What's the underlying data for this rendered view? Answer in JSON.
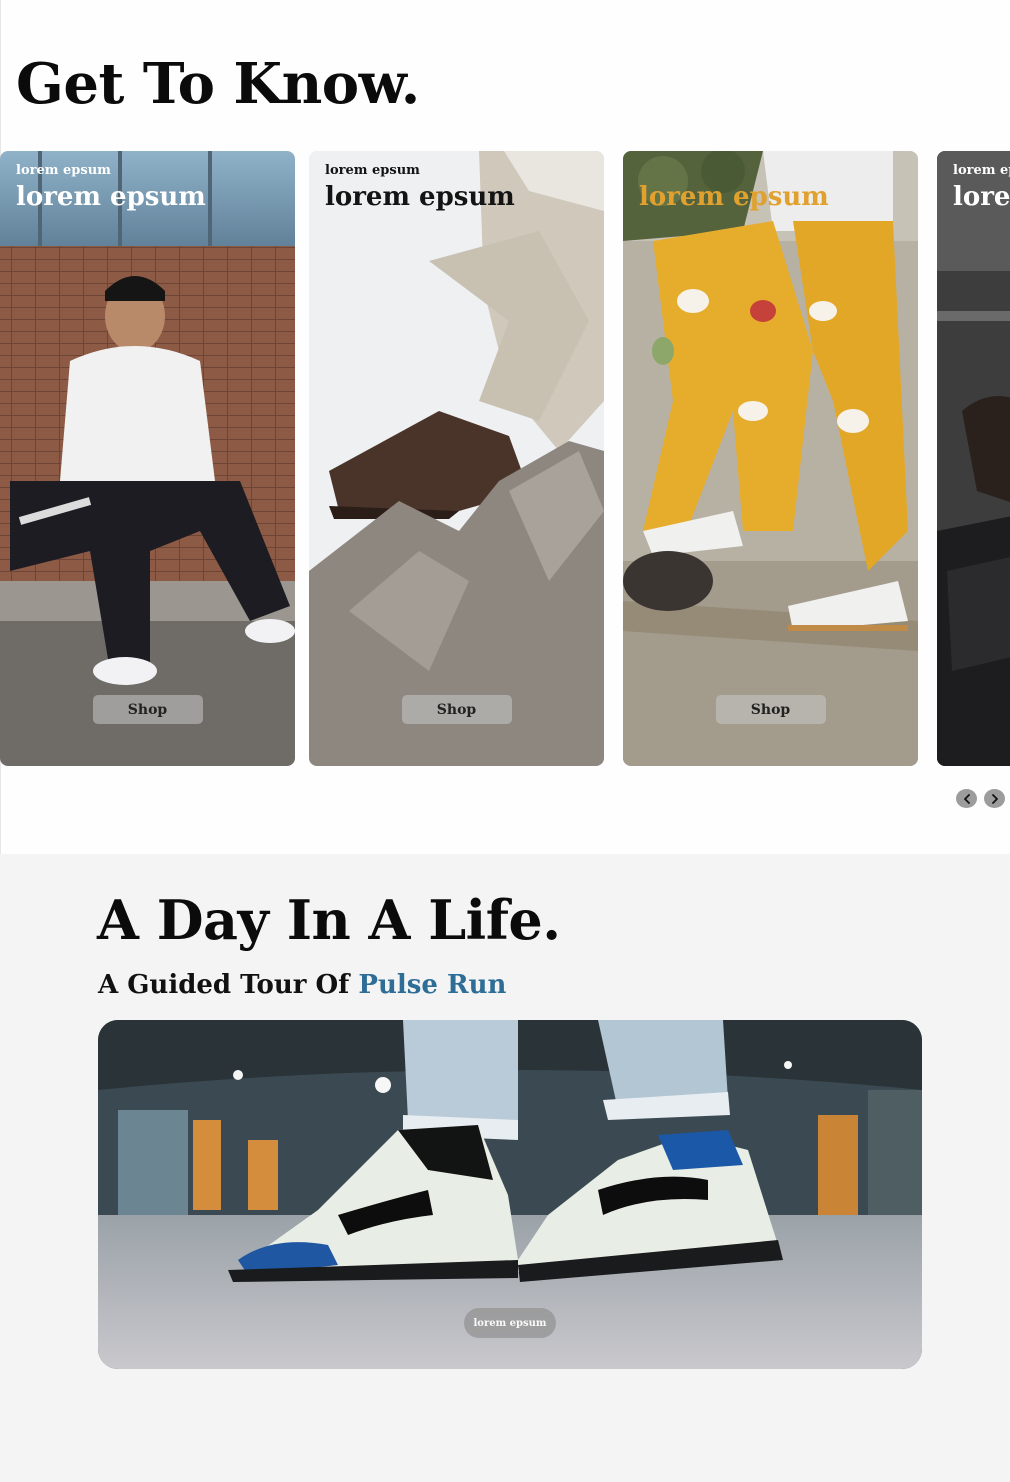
{
  "get_to_know": {
    "title": "Get To Know.",
    "cards": [
      {
        "kicker": "lorem epsum",
        "headline": "lorem epsum",
        "button": "Shop"
      },
      {
        "kicker": "lorem epsum",
        "headline": "lorem epsum",
        "button": "Shop"
      },
      {
        "kicker": "",
        "headline": "lorem epsum",
        "button": "Shop"
      },
      {
        "kicker": "lorem ep",
        "headline": "lore",
        "button": ""
      }
    ],
    "nav": {
      "prev_icon": "chevron-left-icon",
      "next_icon": "chevron-right-icon"
    }
  },
  "day_in_life": {
    "title": "A Day In A Life.",
    "subtitle_prefix": "A Guided Tour Of ",
    "subtitle_accent": "Pulse Run",
    "hero_button": "lorem epsum"
  },
  "colors": {
    "accent": "#2e6d96",
    "card3_headline": "#e0a12f",
    "section2_bg": "#f4f4f4"
  }
}
